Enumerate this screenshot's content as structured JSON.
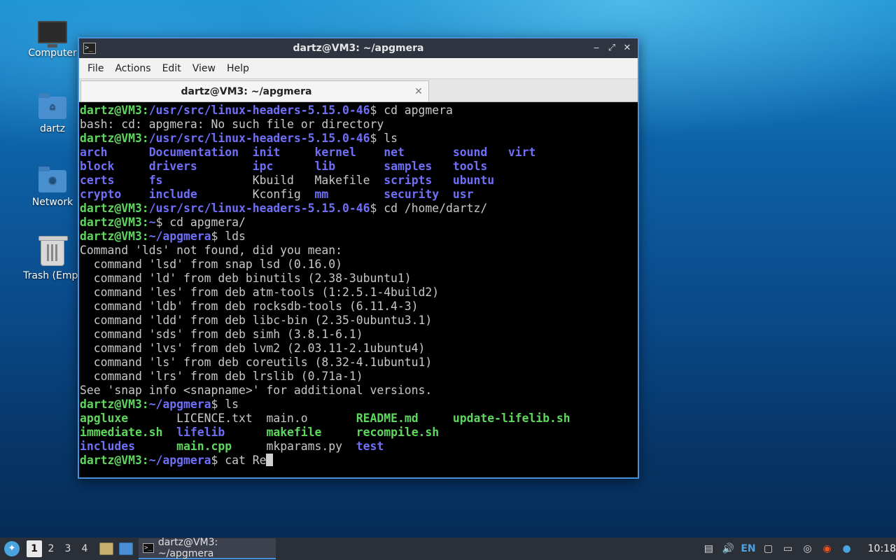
{
  "desktop": {
    "icons": [
      {
        "label": "Computer",
        "icon": "computer-icon"
      },
      {
        "label": "dartz",
        "icon": "home-folder-icon"
      },
      {
        "label": "Network",
        "icon": "network-folder-icon"
      },
      {
        "label": "Trash (Empt",
        "icon": "trash-icon"
      }
    ]
  },
  "window": {
    "title": "dartz@VM3: ~/apgmera",
    "menu": [
      "File",
      "Actions",
      "Edit",
      "View",
      "Help"
    ],
    "tab_label": "dartz@VM3: ~/apgmera"
  },
  "terminal": {
    "user": "dartz@VM3",
    "lines": [
      {
        "type": "prompt",
        "path": "/usr/src/linux-headers-5.15.0-46",
        "cmd": "cd apgmera"
      },
      {
        "type": "text",
        "text": "bash: cd: apgmera: No such file or directory"
      },
      {
        "type": "prompt",
        "path": "/usr/src/linux-headers-5.15.0-46",
        "cmd": "ls"
      },
      {
        "type": "grid",
        "cols": [
          10,
          15,
          9,
          10,
          10,
          8,
          5
        ],
        "items": [
          [
            "arch",
            "dir"
          ],
          [
            "Documentation",
            "dir"
          ],
          [
            "init",
            "dir"
          ],
          [
            "kernel",
            "dir"
          ],
          [
            "net",
            "dir"
          ],
          [
            "sound",
            "dir"
          ],
          [
            "virt",
            "dir"
          ]
        ]
      },
      {
        "type": "grid",
        "cols": [
          10,
          15,
          9,
          10,
          10,
          8,
          5
        ],
        "items": [
          [
            "block",
            "dir"
          ],
          [
            "drivers",
            "dir"
          ],
          [
            "ipc",
            "dir"
          ],
          [
            "lib",
            "dir"
          ],
          [
            "samples",
            "dir"
          ],
          [
            "tools",
            "dir"
          ]
        ]
      },
      {
        "type": "grid",
        "cols": [
          10,
          15,
          9,
          10,
          10,
          8,
          5
        ],
        "items": [
          [
            "certs",
            "dir"
          ],
          [
            "fs",
            "dir"
          ],
          [
            "Kbuild",
            "plain"
          ],
          [
            "Makefile",
            "plain"
          ],
          [
            "scripts",
            "dir"
          ],
          [
            "ubuntu",
            "dir"
          ]
        ]
      },
      {
        "type": "grid",
        "cols": [
          10,
          15,
          9,
          10,
          10,
          8,
          5
        ],
        "items": [
          [
            "crypto",
            "dir"
          ],
          [
            "include",
            "dir"
          ],
          [
            "Kconfig",
            "plain"
          ],
          [
            "mm",
            "dir"
          ],
          [
            "security",
            "dir"
          ],
          [
            "usr",
            "dir"
          ]
        ]
      },
      {
        "type": "prompt",
        "path": "/usr/src/linux-headers-5.15.0-46",
        "cmd": "cd /home/dartz/"
      },
      {
        "type": "prompt",
        "path": "~",
        "cmd": "cd apgmera/"
      },
      {
        "type": "prompt",
        "path": "~/apgmera",
        "cmd": "lds"
      },
      {
        "type": "text",
        "text": "Command 'lds' not found, did you mean:"
      },
      {
        "type": "text",
        "text": "  command 'lsd' from snap lsd (0.16.0)"
      },
      {
        "type": "text",
        "text": "  command 'ld' from deb binutils (2.38-3ubuntu1)"
      },
      {
        "type": "text",
        "text": "  command 'les' from deb atm-tools (1:2.5.1-4build2)"
      },
      {
        "type": "text",
        "text": "  command 'ldb' from deb rocksdb-tools (6.11.4-3)"
      },
      {
        "type": "text",
        "text": "  command 'ldd' from deb libc-bin (2.35-0ubuntu3.1)"
      },
      {
        "type": "text",
        "text": "  command 'sds' from deb simh (3.8.1-6.1)"
      },
      {
        "type": "text",
        "text": "  command 'lvs' from deb lvm2 (2.03.11-2.1ubuntu4)"
      },
      {
        "type": "text",
        "text": "  command 'ls' from deb coreutils (8.32-4.1ubuntu1)"
      },
      {
        "type": "text",
        "text": "  command 'lrs' from deb lrslib (0.71a-1)"
      },
      {
        "type": "text",
        "text": "See 'snap info <snapname>' for additional versions."
      },
      {
        "type": "prompt",
        "path": "~/apgmera",
        "cmd": "ls"
      },
      {
        "type": "grid",
        "cols": [
          14,
          13,
          13,
          14,
          17
        ],
        "items": [
          [
            "apgluxe",
            "exe"
          ],
          [
            "LICENCE.txt",
            "plain"
          ],
          [
            "main.o",
            "plain"
          ],
          [
            "README.md",
            "exe"
          ],
          [
            "update-lifelib.sh",
            "exe"
          ]
        ]
      },
      {
        "type": "grid",
        "cols": [
          14,
          13,
          13,
          14,
          17
        ],
        "items": [
          [
            "immediate.sh",
            "exe"
          ],
          [
            "lifelib",
            "dir"
          ],
          [
            "makefile",
            "exe"
          ],
          [
            "recompile.sh",
            "exe"
          ]
        ]
      },
      {
        "type": "grid",
        "cols": [
          14,
          13,
          13,
          14,
          17
        ],
        "items": [
          [
            "includes",
            "dir"
          ],
          [
            "main.cpp",
            "exe"
          ],
          [
            "mkparams.py",
            "plain"
          ],
          [
            "test",
            "dir"
          ]
        ]
      },
      {
        "type": "prompt",
        "path": "~/apgmera",
        "cmd": "cat Re",
        "cursor": true
      }
    ]
  },
  "taskbar": {
    "workspaces": [
      "1",
      "2",
      "3",
      "4"
    ],
    "active_workspace": "1",
    "task_label": "dartz@VM3: ~/apgmera",
    "lang": "EN",
    "clock": "10:18"
  }
}
